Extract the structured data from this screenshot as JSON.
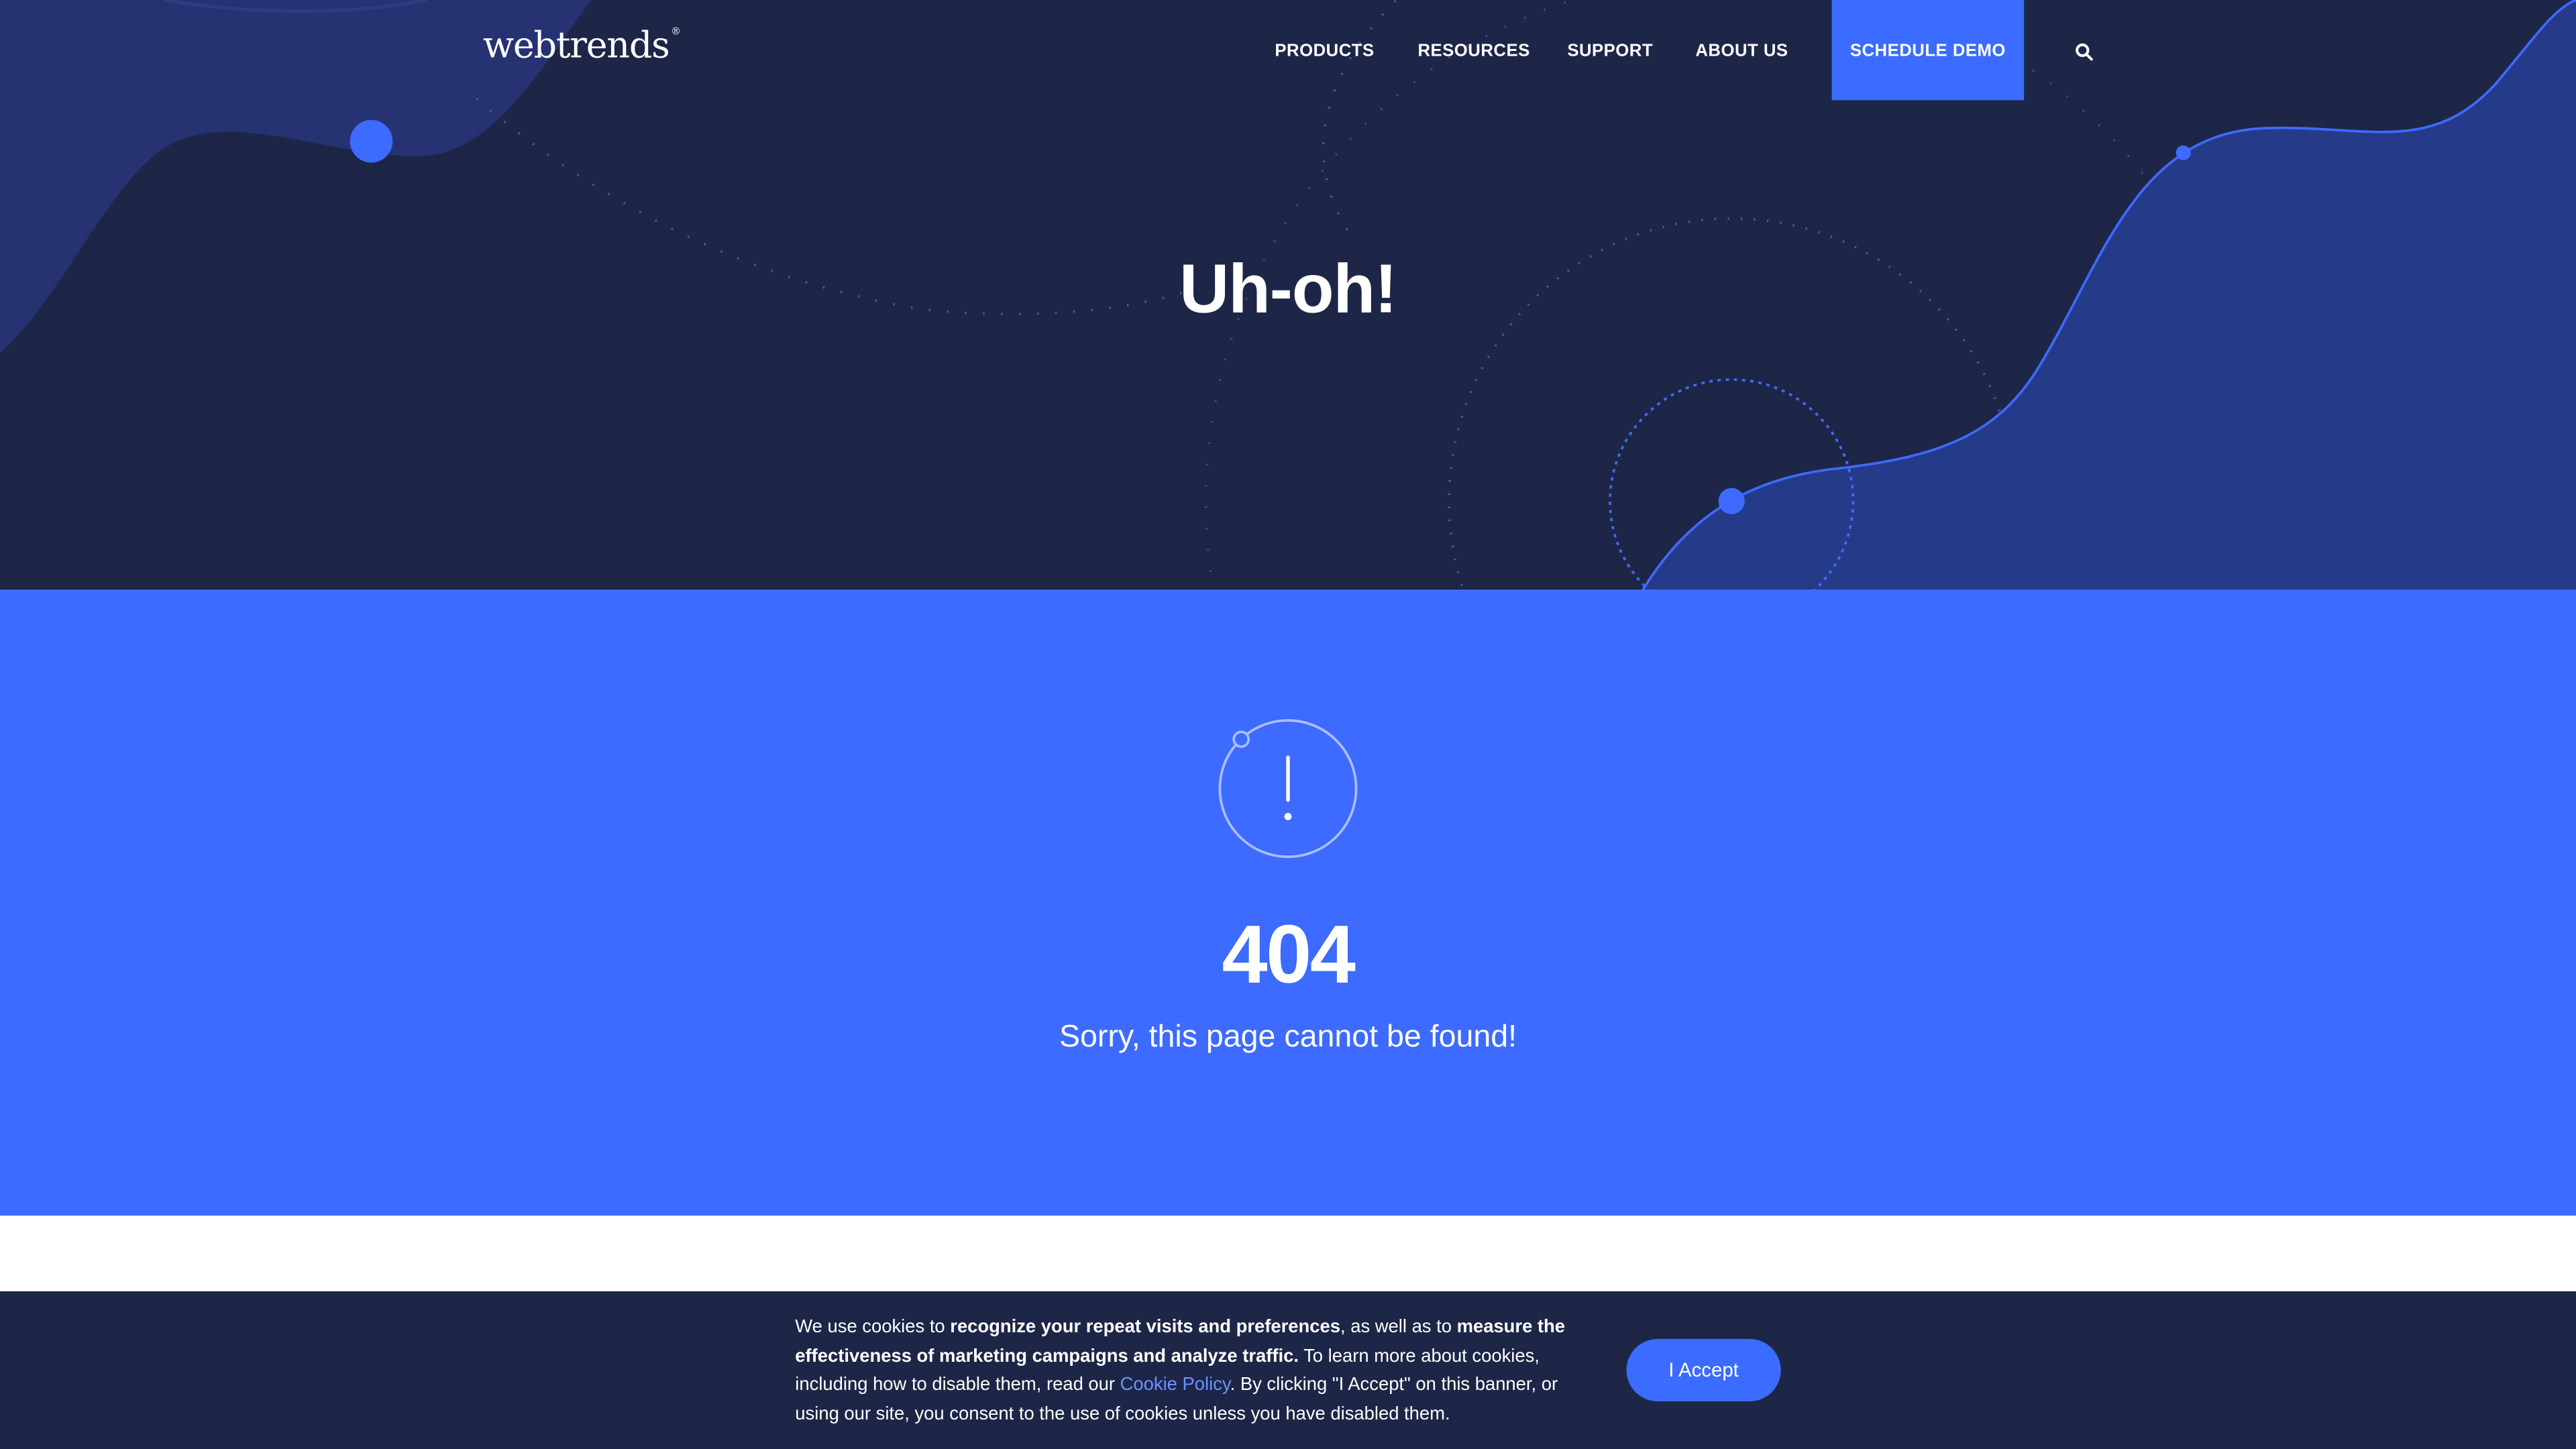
{
  "header": {
    "logo_text": "webtrends",
    "logo_mark": "®",
    "nav": {
      "products": "PRODUCTS",
      "resources": "RESOURCES",
      "support": "SUPPORT",
      "about": "ABOUT US",
      "demo": "SCHEDULE DEMO"
    },
    "search_icon": "search-icon"
  },
  "hero": {
    "title": "Uh-oh!"
  },
  "error": {
    "icon": "exclamation-circle-icon",
    "code": "404",
    "message": "Sorry, this page cannot be found!"
  },
  "cookie": {
    "t1": "We use cookies to ",
    "b1": "recognize your repeat visits and preferences",
    "t2": ", as well as to ",
    "b2": "measure the effectiveness of marketing campaigns and analyze traffic.",
    "t3": " To learn more about cookies, including how to disable them, read our ",
    "link": "Cookie Policy",
    "t4": ". By clicking \"I Accept\" on this banner, or using our site, you consent to the use of cookies unless you have disabled them.",
    "accept": "I Accept"
  },
  "colors": {
    "navy": "#1d2647",
    "blue": "#3d6bff",
    "link": "#6a91ff"
  }
}
